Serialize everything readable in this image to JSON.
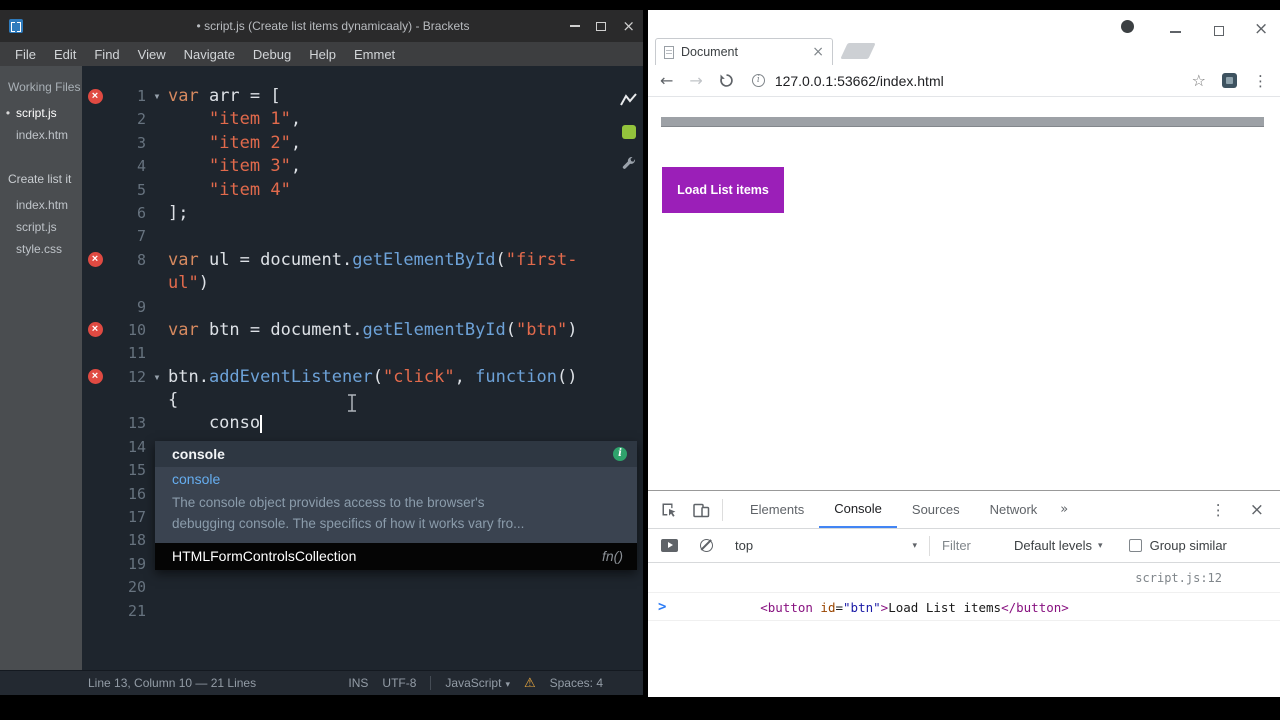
{
  "icons": {
    "close": "×",
    "back": "←",
    "forward": "→",
    "star": "☆",
    "kebab": "⋮",
    "more_tabs": "»",
    "dropdown": "▾",
    "fold_arrow": "▾",
    "prompt": ">",
    "info": "i",
    "warning": "⚠",
    "dirty_dot": "•",
    "error_x": "×"
  },
  "colors": {
    "button_purple": "#9b1fb8",
    "devtools_active_blue": "#4285f4",
    "error_red": "#e04a42",
    "extension_green": "#93c33c"
  },
  "brackets": {
    "titlebar": {
      "title": "• script.js (Create list items dynamicaaly) - Brackets"
    },
    "menu": [
      "File",
      "Edit",
      "Find",
      "View",
      "Navigate",
      "Debug",
      "Help",
      "Emmet"
    ],
    "sidebar": {
      "working_files_header": "Working Files",
      "working_files": [
        {
          "name": "script.js",
          "active": true,
          "dirty": true
        },
        {
          "name": "index.htm",
          "active": false,
          "dirty": false
        }
      ],
      "project_name": "Create list it",
      "project_files": [
        "index.htm",
        "script.js",
        "style.css"
      ]
    },
    "code": {
      "rows": [
        {
          "n": "1",
          "fold": true,
          "err": true,
          "seg": [
            [
              "k",
              "var"
            ],
            [
              "p",
              " arr = ["
            ]
          ]
        },
        {
          "n": "2",
          "seg": [
            [
              "p",
              "    "
            ],
            [
              "s",
              "\"item 1\""
            ],
            [
              "p",
              ","
            ]
          ]
        },
        {
          "n": "3",
          "seg": [
            [
              "p",
              "    "
            ],
            [
              "s",
              "\"item 2\""
            ],
            [
              "p",
              ","
            ]
          ]
        },
        {
          "n": "4",
          "seg": [
            [
              "p",
              "    "
            ],
            [
              "s",
              "\"item 3\""
            ],
            [
              "p",
              ","
            ]
          ]
        },
        {
          "n": "5",
          "seg": [
            [
              "p",
              "    "
            ],
            [
              "s",
              "\"item 4\""
            ]
          ]
        },
        {
          "n": "6",
          "seg": [
            [
              "p",
              "];"
            ]
          ]
        },
        {
          "n": "7",
          "seg": []
        },
        {
          "n": "8",
          "err": true,
          "seg": [
            [
              "k",
              "var"
            ],
            [
              "p",
              " ul = document."
            ],
            [
              "f",
              "getElementById"
            ],
            [
              "p",
              "("
            ],
            [
              "s",
              "\"first-"
            ]
          ]
        },
        {
          "n": "",
          "seg": [
            [
              "s",
              "ul\""
            ],
            [
              "p",
              ")"
            ]
          ]
        },
        {
          "n": "9",
          "seg": []
        },
        {
          "n": "10",
          "err": true,
          "seg": [
            [
              "k",
              "var"
            ],
            [
              "p",
              " btn = document."
            ],
            [
              "f",
              "getElementById"
            ],
            [
              "p",
              "("
            ],
            [
              "s",
              "\"btn\""
            ],
            [
              "p",
              ")"
            ]
          ]
        },
        {
          "n": "11",
          "seg": []
        },
        {
          "n": "12",
          "fold": true,
          "err": true,
          "seg": [
            [
              "p",
              "btn."
            ],
            [
              "f",
              "addEventListener"
            ],
            [
              "p",
              "("
            ],
            [
              "s",
              "\"click\""
            ],
            [
              "p",
              ", "
            ],
            [
              "f",
              "function"
            ],
            [
              "p",
              "()"
            ]
          ]
        },
        {
          "n": "",
          "seg": [
            [
              "p",
              "{"
            ]
          ]
        },
        {
          "n": "13",
          "seg": [
            [
              "p",
              "    conso"
            ],
            [
              "c",
              ""
            ]
          ]
        },
        {
          "n": "14",
          "seg": []
        },
        {
          "n": "15",
          "seg": []
        },
        {
          "n": "16",
          "seg": []
        },
        {
          "n": "17",
          "seg": []
        },
        {
          "n": "18",
          "seg": []
        },
        {
          "n": "19",
          "seg": []
        },
        {
          "n": "20",
          "seg": []
        },
        {
          "n": "21",
          "seg": []
        }
      ]
    },
    "autocomplete": {
      "selected": "console",
      "match": "console",
      "description_line1": "The console object provides access to the browser's",
      "description_line2": "debugging console. The specifics of how it works vary fro...",
      "footer": "HTMLFormControlsCollection",
      "footer_kind": "fn()"
    },
    "statusbar": {
      "position": "Line 13, Column 10 — 21 Lines",
      "ins": "INS",
      "encoding": "UTF-8",
      "language": "JavaScript",
      "spaces": "Spaces: 4"
    }
  },
  "browser": {
    "tab_title": "Document",
    "url": "127.0.0.1:53662/index.html",
    "page": {
      "button_label": "Load List items"
    },
    "devtools": {
      "tabs": [
        "Elements",
        "Console",
        "Sources",
        "Network"
      ],
      "active_tab": "Console",
      "context": "top",
      "filter_placeholder": "Filter",
      "levels": "Default levels",
      "group_similar": "Group similar",
      "log": {
        "segments": [
          [
            "tag",
            "<button"
          ],
          [
            "attr",
            " id"
          ],
          [
            "p",
            "="
          ],
          [
            "val",
            "\"btn\""
          ],
          [
            "tag",
            ">"
          ],
          [
            "txt",
            "Load List items"
          ],
          [
            "tag",
            "</button>"
          ]
        ],
        "source": "script.js:12"
      }
    }
  }
}
